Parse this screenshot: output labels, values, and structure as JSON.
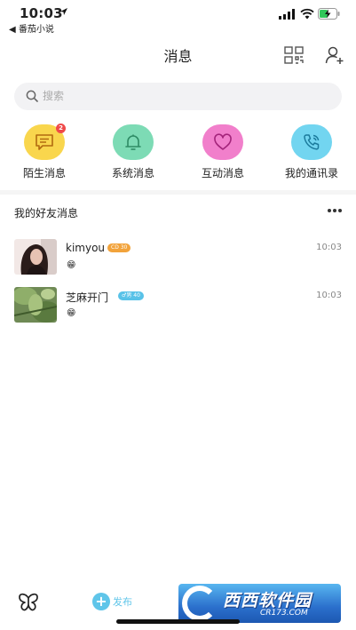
{
  "status_bar": {
    "time": "10:03",
    "back_app": "◀ 番茄小说"
  },
  "header": {
    "title": "消息"
  },
  "search": {
    "placeholder": "搜索"
  },
  "quick_actions": [
    {
      "label": "陌生消息",
      "icon": "chat-bubble-icon",
      "color": "#f9d64d",
      "badge": "2"
    },
    {
      "label": "系统消息",
      "icon": "bell-icon",
      "color": "#7ddbb5"
    },
    {
      "label": "互动消息",
      "icon": "heart-icon",
      "color": "#f17fcb"
    },
    {
      "label": "我的通讯录",
      "icon": "phone-book-icon",
      "color": "#72d5f0"
    }
  ],
  "section": {
    "title": "我的好友消息"
  },
  "conversations": [
    {
      "name": "kimyou",
      "tag": "CD 30",
      "tag_color": "#f2a33b",
      "time": "10:03",
      "preview": "😁"
    },
    {
      "name": "芝麻开门",
      "tag": "♂男 40",
      "tag_color": "#58c2e8",
      "time": "10:03",
      "preview": "😁"
    }
  ],
  "bottom_bar": {
    "publish_label": "发布",
    "publish_icon": "+"
  },
  "watermark": {
    "text": "西西软件园",
    "sub": "CR173.COM"
  }
}
